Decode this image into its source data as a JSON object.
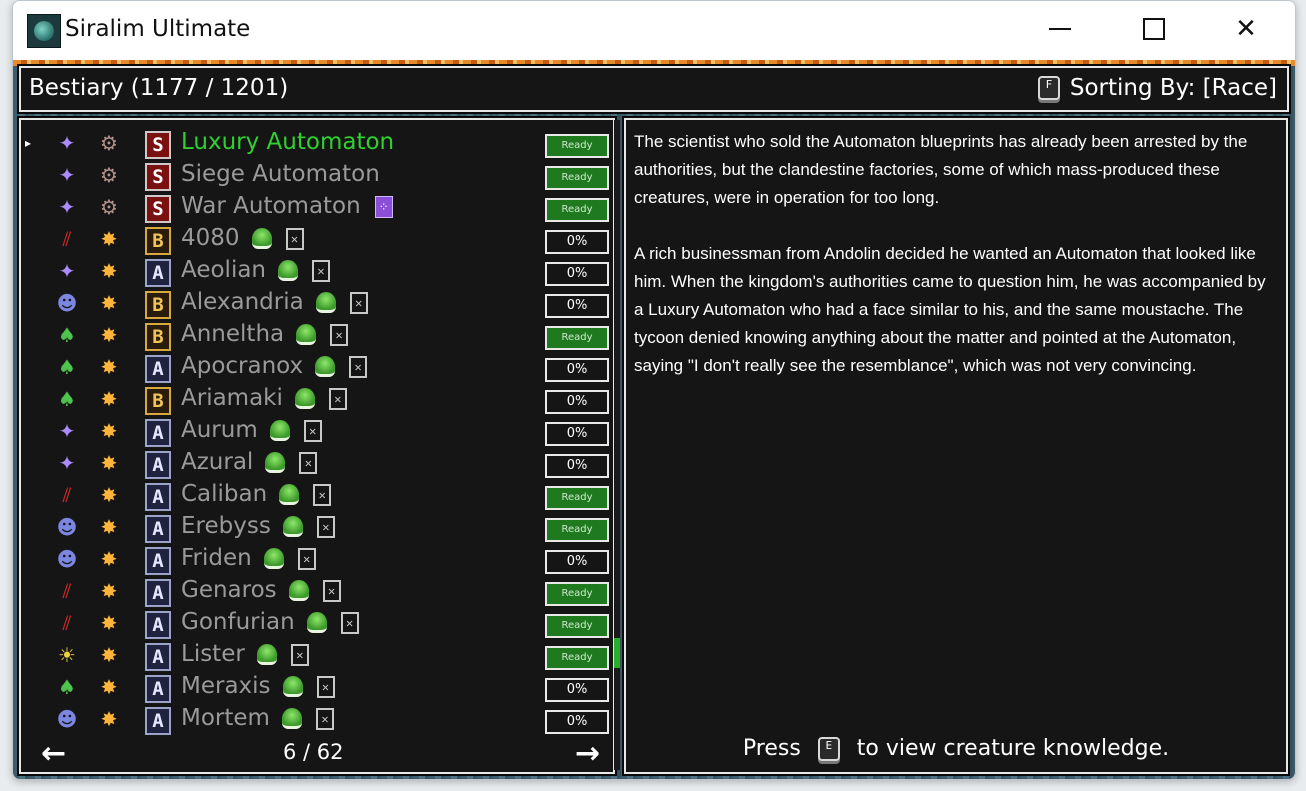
{
  "window": {
    "title": "Siralim Ultimate"
  },
  "header": {
    "title": "Bestiary (1177 / 1201)",
    "sort_key": "F",
    "sort_label": "Sorting By: [Race]"
  },
  "colors": {
    "selected": "#2ed12e",
    "ready_bg": "#1f7a1f",
    "panel_bg": "#151515"
  },
  "creatures": [
    {
      "name": "Luxury Automaton",
      "cls": "sorcery-icon",
      "race": "gear-icon",
      "rank": "S",
      "status": "Ready",
      "selected": true,
      "extra": ""
    },
    {
      "name": "Siege Automaton",
      "cls": "sorcery-icon",
      "race": "gear-icon",
      "rank": "S",
      "status": "Ready",
      "extra": ""
    },
    {
      "name": "War Automaton",
      "cls": "sorcery-icon",
      "race": "gear-icon",
      "rank": "S",
      "status": "Ready",
      "extra": "gem"
    },
    {
      "name": "4080",
      "cls": "chaos-icon",
      "race": "sunburst-icon",
      "rank": "B",
      "status": "0%",
      "extra": "slime-x"
    },
    {
      "name": "Aeolian",
      "cls": "sorcery-icon",
      "race": "sunburst-icon",
      "rank": "A",
      "status": "0%",
      "extra": "slime-x"
    },
    {
      "name": "Alexandria",
      "cls": "death-icon",
      "race": "sunburst-icon",
      "rank": "B",
      "status": "0%",
      "extra": "slime-x"
    },
    {
      "name": "Anneltha",
      "cls": "nature-icon",
      "race": "sunburst-icon",
      "rank": "B",
      "status": "Ready",
      "extra": "slime-x"
    },
    {
      "name": "Apocranox",
      "cls": "nature-icon",
      "race": "sunburst-icon",
      "rank": "A",
      "status": "0%",
      "extra": "slime-x"
    },
    {
      "name": "Ariamaki",
      "cls": "nature-icon",
      "race": "sunburst-icon",
      "rank": "B",
      "status": "0%",
      "extra": "slime-x"
    },
    {
      "name": "Aurum",
      "cls": "sorcery-icon",
      "race": "sunburst-icon",
      "rank": "A",
      "status": "0%",
      "extra": "slime-x"
    },
    {
      "name": "Azural",
      "cls": "sorcery-icon",
      "race": "sunburst-icon",
      "rank": "A",
      "status": "0%",
      "extra": "slime-x"
    },
    {
      "name": "Caliban",
      "cls": "chaos-icon",
      "race": "sunburst-icon",
      "rank": "A",
      "status": "Ready",
      "extra": "slime-x"
    },
    {
      "name": "Erebyss",
      "cls": "death-icon",
      "race": "sunburst-icon",
      "rank": "A",
      "status": "Ready",
      "extra": "slime-x"
    },
    {
      "name": "Friden",
      "cls": "death-icon",
      "race": "sunburst-icon",
      "rank": "A",
      "status": "0%",
      "extra": "slime-x"
    },
    {
      "name": "Genaros",
      "cls": "chaos-icon",
      "race": "sunburst-icon",
      "rank": "A",
      "status": "Ready",
      "extra": "slime-x"
    },
    {
      "name": "Gonfurian",
      "cls": "chaos-icon",
      "race": "sunburst-icon",
      "rank": "A",
      "status": "Ready",
      "extra": "slime-x"
    },
    {
      "name": "Lister",
      "cls": "life-icon",
      "race": "sunburst-icon",
      "rank": "A",
      "status": "Ready",
      "extra": "slime-x"
    },
    {
      "name": "Meraxis",
      "cls": "nature-icon",
      "race": "sunburst-icon",
      "rank": "A",
      "status": "0%",
      "extra": "slime-x"
    },
    {
      "name": "Mortem",
      "cls": "death-icon",
      "race": "sunburst-icon",
      "rank": "A",
      "status": "0%",
      "extra": "slime-x"
    }
  ],
  "pager": {
    "label": "6 / 62"
  },
  "lore": {
    "p1": "The scientist who sold the Automaton blueprints has already been arrested by the authorities, but the clandestine factories, some of which mass-produced these creatures, were in operation for too long.",
    "p2": "A rich businessman from Andolin decided he wanted an Automaton that looked like him. When the kingdom's authorities came to question him, he was accompanied by a Luxury Automaton who had a face similar to his, and the same moustache. The tycoon denied knowing anything about the matter and pointed at the Automaton, saying \"I don't really see the resemblance\", which was not very convincing."
  },
  "footer": {
    "press": "Press",
    "key": "E",
    "rest": "to view creature knowledge."
  }
}
